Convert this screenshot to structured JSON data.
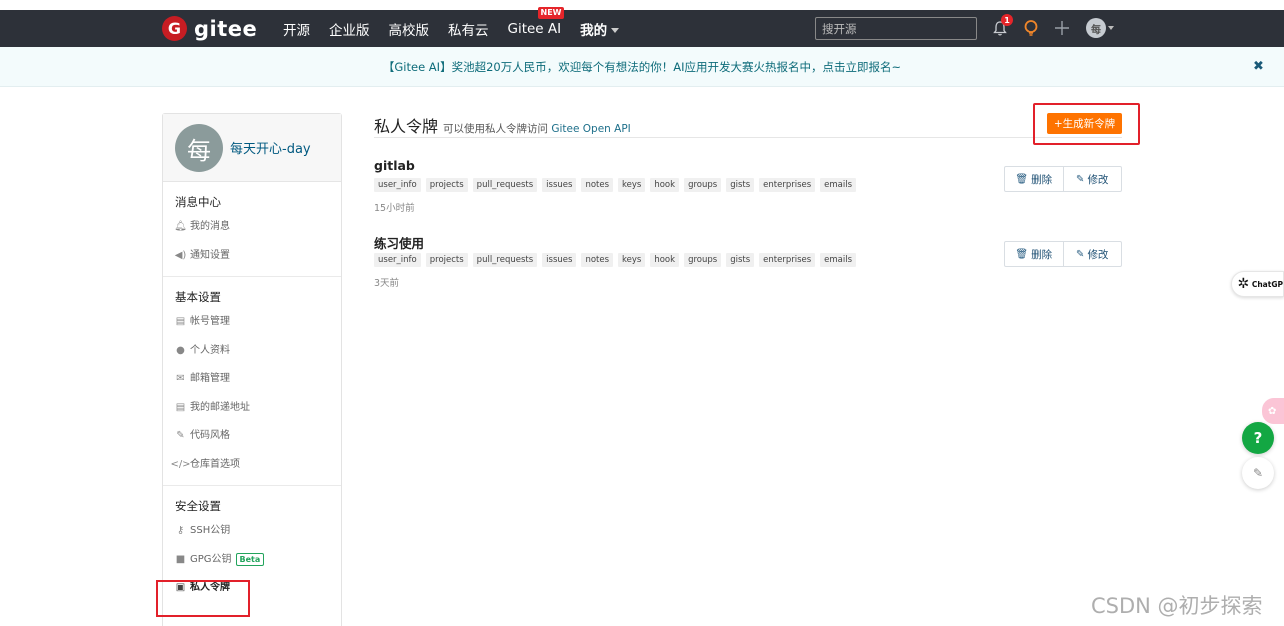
{
  "nav": {
    "logo_mark": "G",
    "logo_text": "gitee",
    "items": [
      "开源",
      "企业版",
      "高校版",
      "私有云",
      "Gitee AI",
      "我的"
    ],
    "new_badge": "NEW",
    "search_placeholder": "搜开源",
    "notification_count": "1",
    "avatar_initial": "每"
  },
  "announcement": {
    "text": "【Gitee AI】奖池超20万人民币，欢迎每个有想法的你！AI应用开发大赛火热报名中，点击立即报名~",
    "close": "✖"
  },
  "sidebar": {
    "avatar_initial": "每",
    "username": "每天开心-day",
    "sections": [
      {
        "title": "消息中心",
        "items": [
          {
            "label": "我的消息",
            "icon": "bell-icon"
          },
          {
            "label": "通知设置",
            "icon": "volume-icon"
          }
        ]
      },
      {
        "title": "基本设置",
        "items": [
          {
            "label": "帐号管理",
            "icon": "id-card-icon"
          },
          {
            "label": "个人资料",
            "icon": "user-icon"
          },
          {
            "label": "邮箱管理",
            "icon": "envelope-icon"
          },
          {
            "label": "我的邮递地址",
            "icon": "address-card-icon"
          },
          {
            "label": "代码风格",
            "icon": "brush-icon"
          },
          {
            "label": "仓库首选项",
            "icon": "code-icon"
          }
        ]
      },
      {
        "title": "安全设置",
        "items": [
          {
            "label": "SSH公钥",
            "icon": "key-icon"
          },
          {
            "label": "GPG公钥",
            "icon": "lock-icon",
            "badge": "Beta"
          },
          {
            "label": "私人令牌",
            "icon": "token-icon",
            "active": true
          }
        ]
      }
    ]
  },
  "main": {
    "title": "私人令牌",
    "subtitle_prefix": "可以使用私人令牌访问",
    "subtitle_link": "Gitee Open API",
    "generate_button": "+生成新令牌",
    "delete_label": "删除",
    "edit_label": "修改",
    "tokens": [
      {
        "name": "gitlab",
        "scopes": [
          "user_info",
          "projects",
          "pull_requests",
          "issues",
          "notes",
          "keys",
          "hook",
          "groups",
          "gists",
          "enterprises",
          "emails"
        ],
        "time": "15小时前"
      },
      {
        "name": "练习使用",
        "scopes": [
          "user_info",
          "projects",
          "pull_requests",
          "issues",
          "notes",
          "keys",
          "hook",
          "groups",
          "gists",
          "enterprises",
          "emails"
        ],
        "time": "3天前"
      }
    ]
  },
  "floating": {
    "chatgpt_label": "ChatGP",
    "help": "?",
    "watermark": "CSDN @初步探索"
  },
  "colors": {
    "navbar": "#2d3139",
    "accent_orange": "#fe7300",
    "highlight_red": "#e2202a",
    "help_green": "#13a743"
  }
}
